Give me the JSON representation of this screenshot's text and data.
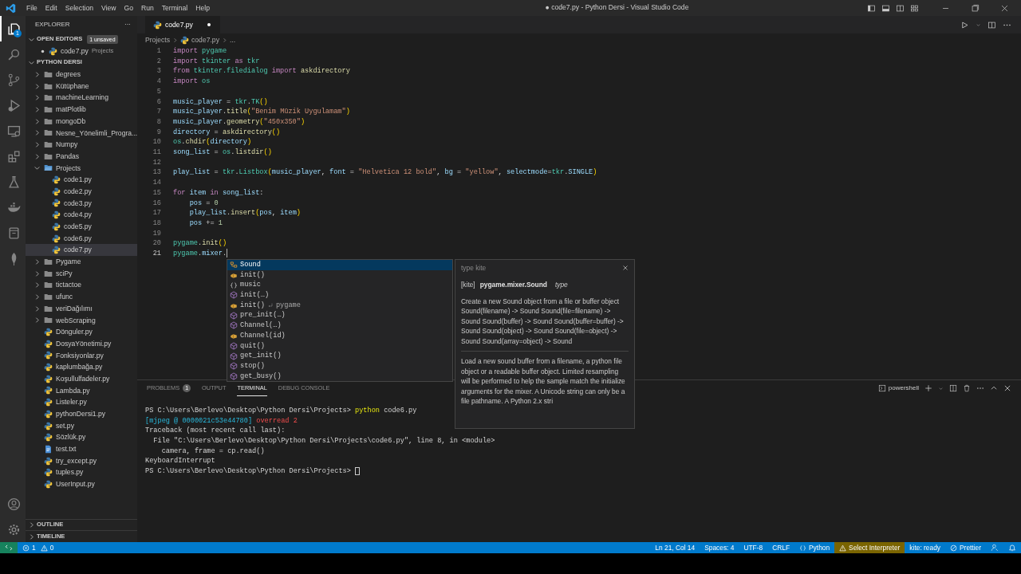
{
  "window": {
    "title": "● code7.py - Python Dersi - Visual Studio Code",
    "menu": [
      "File",
      "Edit",
      "Selection",
      "View",
      "Go",
      "Run",
      "Terminal",
      "Help"
    ]
  },
  "activity_bar": [
    {
      "kind": "explorer",
      "selected": true,
      "badge": "1"
    },
    {
      "kind": "search",
      "selected": false
    },
    {
      "kind": "scm",
      "selected": false
    },
    {
      "kind": "run",
      "selected": false
    },
    {
      "kind": "remote",
      "selected": false
    },
    {
      "kind": "extensions",
      "selected": false
    },
    {
      "kind": "testing",
      "selected": false
    },
    {
      "kind": "docker",
      "selected": false
    },
    {
      "kind": "notebook",
      "selected": false
    },
    {
      "kind": "leaf",
      "selected": false
    }
  ],
  "activity_bottom": [
    {
      "kind": "account"
    },
    {
      "kind": "settings"
    }
  ],
  "explorer": {
    "title": "EXPLORER",
    "more": "···",
    "open_editors": {
      "title": "OPEN EDITORS",
      "badge": "1 unsaved",
      "expanded": true,
      "items": [
        {
          "name": "code7.py",
          "detail": "Projects",
          "kind": "python",
          "modified": true
        }
      ]
    },
    "folder": {
      "title": "PYTHON DERSI",
      "expanded": true,
      "items": [
        {
          "name": "degrees",
          "kind": "folder",
          "expanded": false,
          "selected": false
        },
        {
          "name": "Kütüphane",
          "kind": "folder",
          "expanded": false,
          "selected": false
        },
        {
          "name": "machineLearning",
          "kind": "folder",
          "expanded": false,
          "selected": false
        },
        {
          "name": "matPlotlib",
          "kind": "folder",
          "expanded": false,
          "selected": false
        },
        {
          "name": "mongoDb",
          "kind": "folder",
          "expanded": false,
          "selected": false
        },
        {
          "name": "Nesne_Yönelimli_Progra...",
          "kind": "folder",
          "expanded": false,
          "selected": false
        },
        {
          "name": "Numpy",
          "kind": "folder",
          "expanded": false,
          "selected": false
        },
        {
          "name": "Pandas",
          "kind": "folder",
          "expanded": false,
          "selected": false
        },
        {
          "name": "Projects",
          "kind": "folder",
          "expanded": true,
          "selected": false,
          "children": [
            {
              "name": "code1.py",
              "kind": "python",
              "selected": false
            },
            {
              "name": "code2.py",
              "kind": "python",
              "selected": false
            },
            {
              "name": "code3.py",
              "kind": "python",
              "selected": false
            },
            {
              "name": "code4.py",
              "kind": "python",
              "selected": false
            },
            {
              "name": "code5.py",
              "kind": "python",
              "selected": false
            },
            {
              "name": "code6.py",
              "kind": "python",
              "selected": false
            },
            {
              "name": "code7.py",
              "kind": "python",
              "selected": true
            }
          ]
        },
        {
          "name": "Pygame",
          "kind": "folder",
          "expanded": false,
          "selected": false
        },
        {
          "name": "sciPy",
          "kind": "folder",
          "expanded": false,
          "selected": false
        },
        {
          "name": "tictactoe",
          "kind": "folder",
          "expanded": false,
          "selected": false
        },
        {
          "name": "ufunc",
          "kind": "folder",
          "expanded": false,
          "selected": false
        },
        {
          "name": "veriDağılımı",
          "kind": "folder",
          "expanded": false,
          "selected": false
        },
        {
          "name": "webScraping",
          "kind": "folder",
          "expanded": false,
          "selected": false
        },
        {
          "name": "Dönguler.py",
          "kind": "python",
          "selected": false
        },
        {
          "name": "DosyaYönetimi.py",
          "kind": "python",
          "selected": false
        },
        {
          "name": "Fonksiyonlar.py",
          "kind": "python",
          "selected": false
        },
        {
          "name": "kaplumbağa.py",
          "kind": "python",
          "selected": false
        },
        {
          "name": "Koşullulfadeler.py",
          "kind": "python",
          "selected": false
        },
        {
          "name": "Lambda.py",
          "kind": "python",
          "selected": false
        },
        {
          "name": "Listeler.py",
          "kind": "python",
          "selected": false
        },
        {
          "name": "pythonDersi1.py",
          "kind": "python",
          "selected": false
        },
        {
          "name": "set.py",
          "kind": "python",
          "selected": false
        },
        {
          "name": "Sözlük.py",
          "kind": "python",
          "selected": false
        },
        {
          "name": "test.txt",
          "kind": "text",
          "selected": false
        },
        {
          "name": "try_except.py",
          "kind": "python",
          "selected": false
        },
        {
          "name": "tuples.py",
          "kind": "python",
          "selected": false
        },
        {
          "name": "UserInput.py",
          "kind": "python",
          "selected": false
        }
      ]
    },
    "sections": [
      {
        "title": "OUTLINE",
        "expanded": false
      },
      {
        "title": "TIMELINE",
        "expanded": false
      }
    ]
  },
  "tabs": [
    {
      "label": "code7.py",
      "kind": "python",
      "selected": true,
      "modified": true
    }
  ],
  "breadcrumb": [
    "Projects",
    "code7.py",
    "..."
  ],
  "code": [
    {
      "number": "1",
      "current": false,
      "tokens": [
        {
          "text": "import ",
          "kind": "kw"
        },
        {
          "text": "pygame",
          "kind": "mod"
        }
      ]
    },
    {
      "number": "2",
      "current": false,
      "tokens": [
        {
          "text": "import ",
          "kind": "kw"
        },
        {
          "text": "tkinter ",
          "kind": "mod"
        },
        {
          "text": "as ",
          "kind": "kw"
        },
        {
          "text": "tkr",
          "kind": "mod"
        }
      ]
    },
    {
      "number": "3",
      "current": false,
      "tokens": [
        {
          "text": "from ",
          "kind": "kw"
        },
        {
          "text": "tkinter.filedialog ",
          "kind": "mod"
        },
        {
          "text": "import ",
          "kind": "kw"
        },
        {
          "text": "askdirectory",
          "kind": "fn"
        }
      ]
    },
    {
      "number": "4",
      "current": false,
      "tokens": [
        {
          "text": "import ",
          "kind": "kw"
        },
        {
          "text": "os",
          "kind": "mod"
        }
      ]
    },
    {
      "number": "5",
      "current": false
    },
    {
      "number": "6",
      "current": false,
      "tokens": [
        {
          "text": "music_player",
          "kind": "var"
        },
        {
          "text": " = ",
          "kind": "p"
        },
        {
          "text": "tkr",
          "kind": "mod"
        },
        {
          "text": ".",
          "kind": "p"
        },
        {
          "text": "TK",
          "kind": "mod"
        },
        {
          "text": "()",
          "kind": "br"
        }
      ]
    },
    {
      "number": "7",
      "current": false,
      "tokens": [
        {
          "text": "music_player",
          "kind": "var"
        },
        {
          "text": ".",
          "kind": "p"
        },
        {
          "text": "title",
          "kind": "fn"
        },
        {
          "text": "(",
          "kind": "br"
        },
        {
          "text": "\"Benim Müzik Uygulamam\"",
          "kind": "str"
        },
        {
          "text": ")",
          "kind": "br"
        }
      ]
    },
    {
      "number": "8",
      "current": false,
      "tokens": [
        {
          "text": "music_player",
          "kind": "var"
        },
        {
          "text": ".",
          "kind": "p"
        },
        {
          "text": "geometry",
          "kind": "fn"
        },
        {
          "text": "(",
          "kind": "br"
        },
        {
          "text": "\"450x350\"",
          "kind": "str"
        },
        {
          "text": ")",
          "kind": "br"
        }
      ]
    },
    {
      "number": "9",
      "current": false,
      "tokens": [
        {
          "text": "directory",
          "kind": "var"
        },
        {
          "text": " = ",
          "kind": "p"
        },
        {
          "text": "askdirectory",
          "kind": "fn"
        },
        {
          "text": "()",
          "kind": "br"
        }
      ]
    },
    {
      "number": "10",
      "current": false,
      "tokens": [
        {
          "text": "os",
          "kind": "mod"
        },
        {
          "text": ".",
          "kind": "p"
        },
        {
          "text": "chdir",
          "kind": "fn"
        },
        {
          "text": "(",
          "kind": "br"
        },
        {
          "text": "directory",
          "kind": "var"
        },
        {
          "text": ")",
          "kind": "br"
        }
      ]
    },
    {
      "number": "11",
      "current": false,
      "tokens": [
        {
          "text": "song_list",
          "kind": "var"
        },
        {
          "text": " = ",
          "kind": "p"
        },
        {
          "text": "os",
          "kind": "mod"
        },
        {
          "text": ".",
          "kind": "p"
        },
        {
          "text": "listdir",
          "kind": "fn"
        },
        {
          "text": "()",
          "kind": "br"
        }
      ]
    },
    {
      "number": "12",
      "current": false
    },
    {
      "number": "13",
      "current": false,
      "tokens": [
        {
          "text": "play_list",
          "kind": "var"
        },
        {
          "text": " = ",
          "kind": "p"
        },
        {
          "text": "tkr",
          "kind": "mod"
        },
        {
          "text": ".",
          "kind": "p"
        },
        {
          "text": "Listbox",
          "kind": "mod"
        },
        {
          "text": "(",
          "kind": "br"
        },
        {
          "text": "music_player",
          "kind": "var"
        },
        {
          "text": ", ",
          "kind": "p"
        },
        {
          "text": "font",
          "kind": "var"
        },
        {
          "text": " = ",
          "kind": "p"
        },
        {
          "text": "\"Helvetica 12 bold\"",
          "kind": "str"
        },
        {
          "text": ", ",
          "kind": "p"
        },
        {
          "text": "bg",
          "kind": "var"
        },
        {
          "text": " = ",
          "kind": "p"
        },
        {
          "text": "\"yellow\"",
          "kind": "str"
        },
        {
          "text": ", ",
          "kind": "p"
        },
        {
          "text": "selectmode",
          "kind": "var"
        },
        {
          "text": "=",
          "kind": "p"
        },
        {
          "text": "tkr",
          "kind": "mod"
        },
        {
          "text": ".",
          "kind": "p"
        },
        {
          "text": "SINGLE",
          "kind": "var"
        },
        {
          "text": ")",
          "kind": "br"
        }
      ]
    },
    {
      "number": "14",
      "current": false
    },
    {
      "number": "15",
      "current": false,
      "tokens": [
        {
          "text": "for ",
          "kind": "kw"
        },
        {
          "text": "item ",
          "kind": "var"
        },
        {
          "text": "in ",
          "kind": "kw"
        },
        {
          "text": "song_list",
          "kind": "var"
        },
        {
          "text": ":",
          "kind": "p"
        }
      ]
    },
    {
      "number": "16",
      "current": false,
      "tokens": [
        {
          "text": "    pos",
          "kind": "var"
        },
        {
          "text": " = ",
          "kind": "p"
        },
        {
          "text": "0",
          "kind": "num"
        }
      ]
    },
    {
      "number": "17",
      "current": false,
      "tokens": [
        {
          "text": "    play_list",
          "kind": "var"
        },
        {
          "text": ".",
          "kind": "p"
        },
        {
          "text": "insert",
          "kind": "fn"
        },
        {
          "text": "(",
          "kind": "br"
        },
        {
          "text": "pos",
          "kind": "var"
        },
        {
          "text": ", ",
          "kind": "p"
        },
        {
          "text": "item",
          "kind": "var"
        },
        {
          "text": ")",
          "kind": "br"
        }
      ]
    },
    {
      "number": "18",
      "current": false,
      "tokens": [
        {
          "text": "    pos",
          "kind": "var"
        },
        {
          "text": " += ",
          "kind": "p"
        },
        {
          "text": "1",
          "kind": "num"
        }
      ]
    },
    {
      "number": "19",
      "current": false
    },
    {
      "number": "20",
      "current": false,
      "tokens": [
        {
          "text": "pygame",
          "kind": "mod"
        },
        {
          "text": ".",
          "kind": "p"
        },
        {
          "text": "init",
          "kind": "fn"
        },
        {
          "text": "()",
          "kind": "br"
        }
      ]
    },
    {
      "number": "21",
      "current": true,
      "tokens": [
        {
          "text": "pygame",
          "kind": "mod"
        },
        {
          "text": ".",
          "kind": "p"
        },
        {
          "text": "mixer",
          "kind": "var"
        },
        {
          "text": ".",
          "kind": "p"
        }
      ]
    }
  ],
  "suggestions": [
    {
      "label": "Sound",
      "kind": "class",
      "selected": true
    },
    {
      "label": "init()",
      "kind": "field",
      "selected": false
    },
    {
      "label": "music",
      "kind": "module",
      "selected": false
    },
    {
      "label": "init(…)",
      "kind": "method",
      "selected": false
    },
    {
      "label": "init()",
      "kind": "field",
      "selected": false,
      "detail": "pygame"
    },
    {
      "label": "pre_init(…)",
      "kind": "method",
      "selected": false
    },
    {
      "label": "Channel(…)",
      "kind": "method",
      "selected": false
    },
    {
      "label": "Channel(id)",
      "kind": "field",
      "selected": false
    },
    {
      "label": "quit()",
      "kind": "method",
      "selected": false
    },
    {
      "label": "get_init()",
      "kind": "method",
      "selected": false
    },
    {
      "label": "stop()",
      "kind": "method",
      "selected": false
    },
    {
      "label": "get_busy()",
      "kind": "method",
      "selected": false
    }
  ],
  "details": {
    "header": "type kite",
    "tag": "[kite]",
    "name": "pygame.mixer.Sound",
    "type": "type",
    "paragraphs": [
      "Create a new Sound object from a file or buffer object Sound(filename) -> Sound Sound(file=filename) -> Sound Sound(buffer) -> Sound Sound(buffer=buffer) -> Sound Sound(object) -> Sound Sound(file=object) -> Sound Sound(array=object) -> Sound",
      "Load a new sound buffer from a filename, a python file object or a readable buffer object. Limited resampling will be performed to help the sample match the initialize arguments for the mixer. A Unicode string can only be a file pathname. A Python 2.x stri"
    ]
  },
  "panel": {
    "tabs": [
      {
        "label": "PROBLEMS",
        "badge": "1",
        "selected": false
      },
      {
        "label": "OUTPUT",
        "selected": false
      },
      {
        "label": "TERMINAL",
        "selected": true
      },
      {
        "label": "DEBUG CONSOLE",
        "selected": false
      }
    ],
    "shell": "powershell",
    "terminal": [
      [
        {
          "text": "PS C:\\Users\\Berlevo\\Desktop\\Python Dersi\\Projects> ",
          "kind": "p"
        },
        {
          "text": "python",
          "kind": "cmd"
        },
        {
          "text": " code6.py",
          "kind": "p"
        }
      ],
      [
        {
          "text": "[mjpeg @ 0000021c53e44780]",
          "kind": "info"
        },
        {
          "text": " overread 2",
          "kind": "err"
        }
      ],
      [
        {
          "text": "Traceback (most recent call last):",
          "kind": "p"
        }
      ],
      [
        {
          "text": "  File \"C:\\Users\\Berlevo\\Desktop\\Python Dersi\\Projects\\code6.py\", line 8, in <module>",
          "kind": "p"
        }
      ],
      [
        {
          "text": "    camera, frame = cp.read()",
          "kind": "p"
        }
      ],
      [
        {
          "text": "KeyboardInterrupt",
          "kind": "p"
        }
      ],
      [
        {
          "text": "PS C:\\Users\\Berlevo\\Desktop\\Python Dersi\\Projects> ",
          "kind": "p"
        },
        {
          "kind": "cursor"
        }
      ]
    ]
  },
  "status_bar": {
    "left": [
      {
        "kind": "remote"
      },
      {
        "kind": "errors",
        "text": "1"
      },
      {
        "kind": "warnings",
        "text": "0"
      }
    ],
    "right": [
      {
        "kind": "plain",
        "text": "Ln 21, Col 14"
      },
      {
        "kind": "plain",
        "text": "Spaces: 4"
      },
      {
        "kind": "plain",
        "text": "UTF-8"
      },
      {
        "kind": "plain",
        "text": "CRLF"
      },
      {
        "kind": "language",
        "text": "Python"
      },
      {
        "kind": "warning",
        "text": "Select Interpreter"
      },
      {
        "kind": "plain",
        "text": "kite: ready"
      },
      {
        "kind": "prettier",
        "text": "Prettier"
      },
      {
        "kind": "feedback"
      },
      {
        "kind": "bell"
      }
    ]
  }
}
